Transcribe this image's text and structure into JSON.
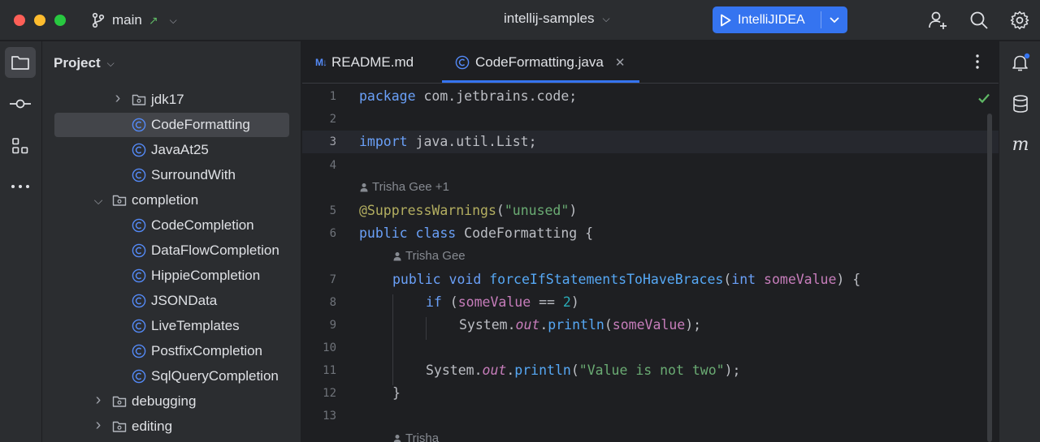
{
  "titlebar": {
    "branch": "main",
    "project": "intellij-samples",
    "run_config": "IntelliJIDEA"
  },
  "project_pane": {
    "title": "Project",
    "tree": [
      {
        "label": "jdk17",
        "type": "folder",
        "expanded": false,
        "depth": 2
      },
      {
        "label": "CodeFormatting",
        "type": "class",
        "depth": 3,
        "selected": true
      },
      {
        "label": "JavaAt25",
        "type": "class",
        "depth": 3
      },
      {
        "label": "SurroundWith",
        "type": "class",
        "depth": 3
      },
      {
        "label": "completion",
        "type": "folder",
        "expanded": true,
        "depth": 1
      },
      {
        "label": "CodeCompletion",
        "type": "class",
        "depth": 3
      },
      {
        "label": "DataFlowCompletion",
        "type": "class",
        "depth": 3
      },
      {
        "label": "HippieCompletion",
        "type": "class",
        "depth": 3
      },
      {
        "label": "JSONData",
        "type": "class",
        "depth": 3
      },
      {
        "label": "LiveTemplates",
        "type": "class",
        "depth": 3
      },
      {
        "label": "PostfixCompletion",
        "type": "class",
        "depth": 3
      },
      {
        "label": "SqlQueryCompletion",
        "type": "class",
        "depth": 3
      },
      {
        "label": "debugging",
        "type": "folder",
        "expanded": false,
        "depth": 1
      },
      {
        "label": "editing",
        "type": "folder",
        "expanded": false,
        "depth": 1
      }
    ]
  },
  "tabs": [
    {
      "label": "README.md",
      "icon": "markdown-icon",
      "icon_text": "M↓",
      "active": false
    },
    {
      "label": "CodeFormatting.java",
      "icon": "class-icon",
      "active": true
    }
  ],
  "editor": {
    "current_line": 3,
    "line_numbers": [
      "1",
      "2",
      "3",
      "4",
      "5",
      "6",
      "7",
      "8",
      "9",
      "10",
      "11",
      "12",
      "13"
    ],
    "authors": [
      "Trisha Gee +1",
      "Trisha Gee",
      "Trisha"
    ],
    "code": {
      "l1_kw": "package",
      "l1_rest": " com.jetbrains.code;",
      "l3_kw": "import",
      "l3_rest": " java.util.List;",
      "l5_ann": "@SuppressWarnings",
      "l5_p1": "(",
      "l5_str": "\"unused\"",
      "l5_p2": ")",
      "l6_kw1": "public",
      "l6_kw2": "class",
      "l6_rest": " CodeFormatting {",
      "l7_kw1": "public",
      "l7_kw2": "void",
      "l7_fn": "forceIfStatementsToHaveBraces",
      "l7_p1": "(",
      "l7_kw3": "int",
      "l7_param": "someValue",
      "l7_p2": ") {",
      "l8_kw": "if",
      "l8_p1": " (",
      "l8_param": "someValue",
      "l8_op": " == ",
      "l8_num": "2",
      "l8_p2": ")",
      "l9_a": "System.",
      "l9_stat": "out",
      "l9_b": ".",
      "l9_fn": "println",
      "l9_p1": "(",
      "l9_param": "someValue",
      "l9_p2": ");",
      "l11_a": "System.",
      "l11_stat": "out",
      "l11_b": ".",
      "l11_fn": "println",
      "l11_p1": "(",
      "l11_str": "\"Value is not two\"",
      "l11_p2": ");",
      "l12": "}"
    }
  },
  "colors": {
    "accent": "#3574f0",
    "keyword": "#cf8e6d",
    "string": "#6aab73",
    "annotation": "#b3ae60",
    "function": "#56a8f5",
    "parameter": "#c77dbb",
    "number": "#2aacb8"
  }
}
